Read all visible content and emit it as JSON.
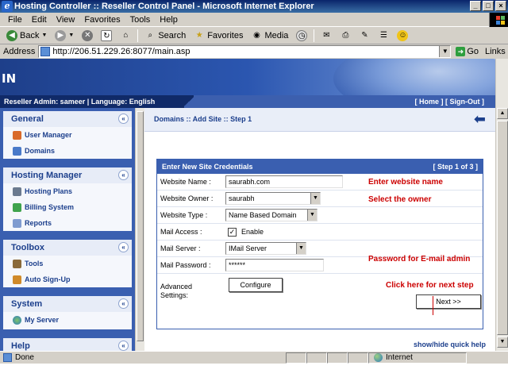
{
  "window": {
    "title": "Hosting Controller :: Reseller Control Panel - Microsoft Internet Explorer"
  },
  "menu": [
    "File",
    "Edit",
    "View",
    "Favorites",
    "Tools",
    "Help"
  ],
  "toolbar": {
    "back": "Back",
    "search": "Search",
    "favorites": "Favorites",
    "media": "Media"
  },
  "address": {
    "label": "Address",
    "url": "http://206.51.229.26:8077/main.asp",
    "go": "Go",
    "links": "Links"
  },
  "banner": {
    "logo_text": "IN",
    "user_info": "Reseller Admin: sameer | Language: English",
    "home": "[ Home ]",
    "signout": "[ Sign-Out ]"
  },
  "sidebar": {
    "sections": [
      {
        "title": "General",
        "items": [
          "User Manager",
          "Domains"
        ]
      },
      {
        "title": "Hosting Manager",
        "items": [
          "Hosting Plans",
          "Billing System",
          "Reports"
        ]
      },
      {
        "title": "Toolbox",
        "items": [
          "Tools",
          "Auto Sign-Up"
        ]
      },
      {
        "title": "System",
        "items": [
          "My Server"
        ]
      },
      {
        "title": "Help",
        "items": []
      }
    ],
    "collapse_glyph": "«"
  },
  "main": {
    "breadcrumb": "Domains :: Add Site :: Step 1",
    "back_glyph": "⬅",
    "panel_title": "Enter New Site Credentials",
    "panel_step": "[ Step 1 of 3 ]",
    "fields": {
      "website_name_label": "Website Name :",
      "website_name_value": "saurabh.com",
      "website_owner_label": "Website Owner :",
      "website_owner_value": "saurabh",
      "website_type_label": "Website Type :",
      "website_type_value": "Name Based Domain",
      "mail_access_label": "Mail Access :",
      "mail_access_enable": "Enable",
      "mail_server_label": "Mail Server :",
      "mail_server_value": "IMail Server",
      "mail_password_label": "Mail Password :",
      "mail_password_value": "******",
      "advanced_label_1": "Advanced",
      "advanced_label_2": "Settings:",
      "configure_button": "Configure",
      "next_button": "Next  >>"
    },
    "annotations": {
      "enter_name": "Enter website name",
      "select_owner": "Select the owner",
      "password_hint": "Password for E-mail admin",
      "next_hint": "Click here for next step"
    },
    "quick_help": "show/hide quick help"
  },
  "status": {
    "text": "Done",
    "zone": "Internet"
  }
}
